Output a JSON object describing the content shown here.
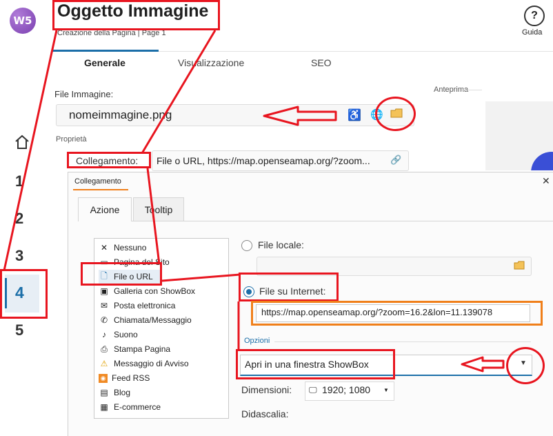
{
  "header": {
    "logo_text": "W5",
    "title": "Oggetto Immagine",
    "subtitle": "Creazione della Pagina | Page 1",
    "help_label": "Guida"
  },
  "tabs": [
    "Generale",
    "Visualizzazione",
    "SEO"
  ],
  "steps": [
    "1",
    "2",
    "3",
    "4",
    "5"
  ],
  "active_step": "4",
  "file_image": {
    "label": "File Immagine:",
    "value": "nomeimmagine.png"
  },
  "preview_label": "Anteprima",
  "properties": {
    "label": "Proprietà",
    "link_label": "Collegamento:",
    "link_value": "File o URL, https://map.openseamap.org/?zoom..."
  },
  "dialog": {
    "title": "Collegamento",
    "close": "✕",
    "tabs": [
      "Azione",
      "Tooltip"
    ],
    "actions": [
      {
        "label": "Nessuno",
        "icon": "x-icon"
      },
      {
        "label": "Pagina del Sito",
        "icon": "page-icon"
      },
      {
        "label": "File o URL",
        "icon": "file-link-icon"
      },
      {
        "label": "Galleria con ShowBox",
        "icon": "gallery-icon"
      },
      {
        "label": "Posta elettronica",
        "icon": "mail-icon"
      },
      {
        "label": "Chiamata/Messaggio",
        "icon": "phone-icon"
      },
      {
        "label": "Suono",
        "icon": "sound-icon"
      },
      {
        "label": "Stampa Pagina",
        "icon": "printer-icon"
      },
      {
        "label": "Messaggio di Avviso",
        "icon": "warning-icon"
      },
      {
        "label": "Feed RSS",
        "icon": "rss-icon"
      },
      {
        "label": "Blog",
        "icon": "blog-icon"
      },
      {
        "label": "E-commerce",
        "icon": "cart-icon"
      }
    ],
    "local_file_label": "File locale:",
    "internet_file_label": "File su Internet:",
    "url_value": "https://map.openseamap.org/?zoom=16.2&lon=11.139078",
    "options_label": "Opzioni",
    "open_mode": "Apri in una finestra ShowBox",
    "dimensions_label": "Dimensioni:",
    "dimensions_value": "1920; 1080",
    "caption_label": "Didascalia:"
  },
  "colors": {
    "accent": "#1b6ea8",
    "annotation_red": "#e8151f",
    "annotation_orange": "#f07f1a"
  }
}
